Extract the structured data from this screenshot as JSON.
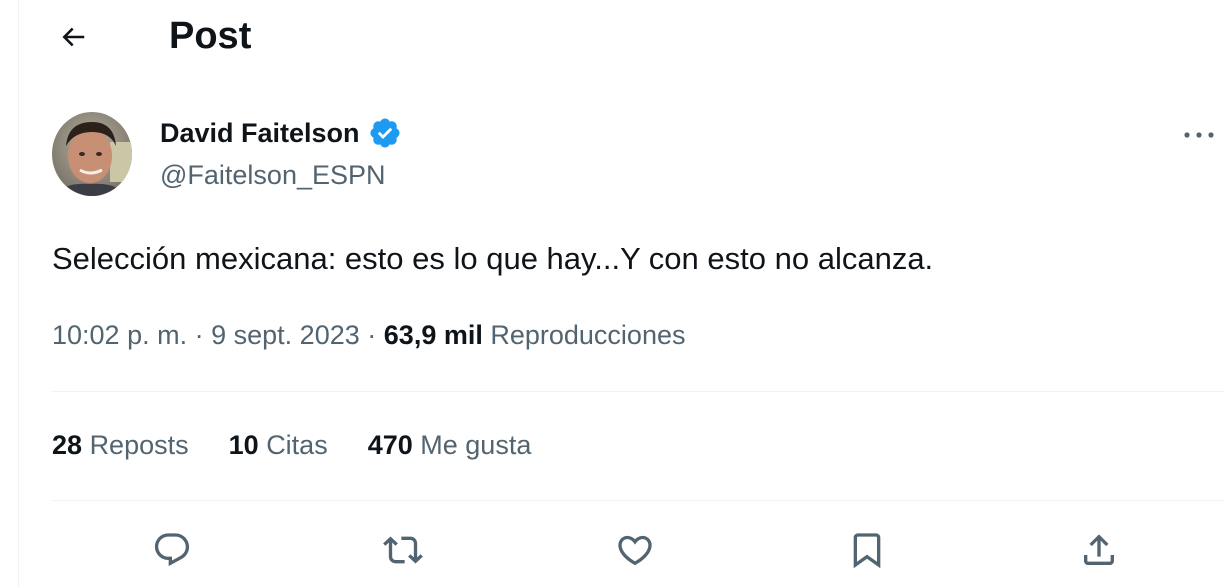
{
  "header": {
    "title": "Post",
    "back_icon": "arrow-left-icon"
  },
  "author": {
    "name": "David Faitelson",
    "handle": "@Faitelson_ESPN",
    "verified": true,
    "verified_color": "#1d9bf0",
    "avatar_icon": "avatar-photo"
  },
  "post": {
    "text": "Selección mexicana: esto es lo que hay...Y con esto no alcanza.",
    "time": "10:02 p. m.",
    "separator": "·",
    "date": "9 sept. 2023",
    "views_count": "63,9 mil",
    "views_label": "Reproducciones"
  },
  "stats": [
    {
      "count": "28",
      "label": "Reposts"
    },
    {
      "count": "10",
      "label": "Citas"
    },
    {
      "count": "470",
      "label": "Me gusta"
    }
  ],
  "actions": [
    {
      "icon": "reply-icon"
    },
    {
      "icon": "repost-icon"
    },
    {
      "icon": "like-icon"
    },
    {
      "icon": "bookmark-icon"
    },
    {
      "icon": "share-icon"
    }
  ],
  "colors": {
    "text_primary": "#0f1419",
    "text_secondary": "#536471",
    "divider": "#eff3f4",
    "brand_blue": "#1d9bf0"
  }
}
